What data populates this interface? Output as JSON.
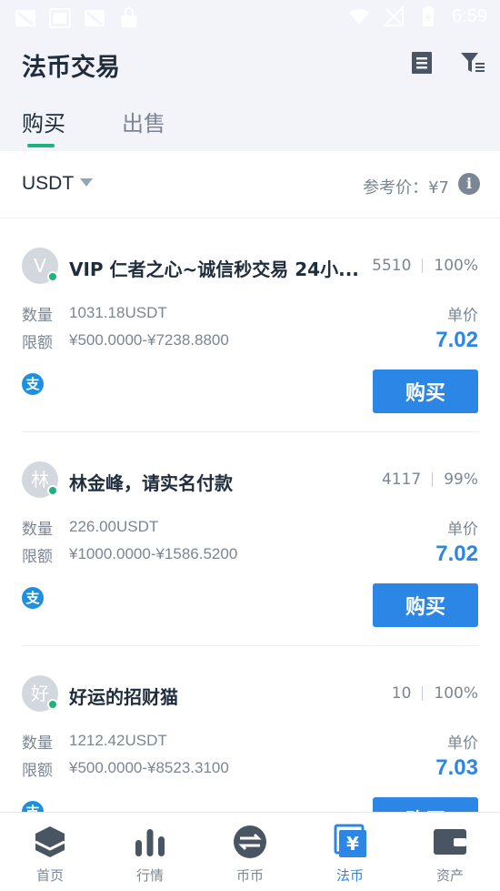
{
  "status_bar": {
    "time": "6:59"
  },
  "header": {
    "title": "法币交易",
    "orders_icon": "document-icon",
    "filter_icon": "filter-icon"
  },
  "tabs": [
    {
      "label": "购买",
      "active": true
    },
    {
      "label": "出售",
      "active": false
    }
  ],
  "filter": {
    "coin": "USDT",
    "reference_price": "参考价：¥7"
  },
  "colors": {
    "accent": "#2b86e5",
    "online": "#20b27c",
    "tab_indicator": "#20b27c"
  },
  "labels": {
    "quantity": "数量",
    "limit": "限额",
    "unit_price": "单价"
  },
  "orders": [
    {
      "avatar": "V",
      "merchant": "VIP 仁者之心~诚信秒交易  24小...",
      "trades": "5510",
      "completion": "100%",
      "quantity": "1031.18USDT",
      "limit": "¥500.0000-¥7238.8800",
      "price": "7.02",
      "payment": "alipay-icon",
      "payment_glyph": "支",
      "button": "购买"
    },
    {
      "avatar": "林",
      "merchant": "林金峰，请实名付款",
      "trades": "4117",
      "completion": "99%",
      "quantity": "226.00USDT",
      "limit": "¥1000.0000-¥1586.5200",
      "price": "7.02",
      "payment": "alipay-icon",
      "payment_glyph": "支",
      "button": "购买"
    },
    {
      "avatar": "好",
      "merchant": "好运的招财猫",
      "trades": "10",
      "completion": "100%",
      "quantity": "1212.42USDT",
      "limit": "¥500.0000-¥8523.3100",
      "price": "7.03",
      "payment": "alipay-icon",
      "payment_glyph": "支",
      "button": "购买"
    }
  ],
  "bottom_nav": [
    {
      "label": "首页",
      "icon": "home-icon"
    },
    {
      "label": "行情",
      "icon": "market-icon"
    },
    {
      "label": "币币",
      "icon": "exchange-icon"
    },
    {
      "label": "法币",
      "icon": "fiat-icon",
      "active": true
    },
    {
      "label": "资产",
      "icon": "wallet-icon"
    }
  ]
}
